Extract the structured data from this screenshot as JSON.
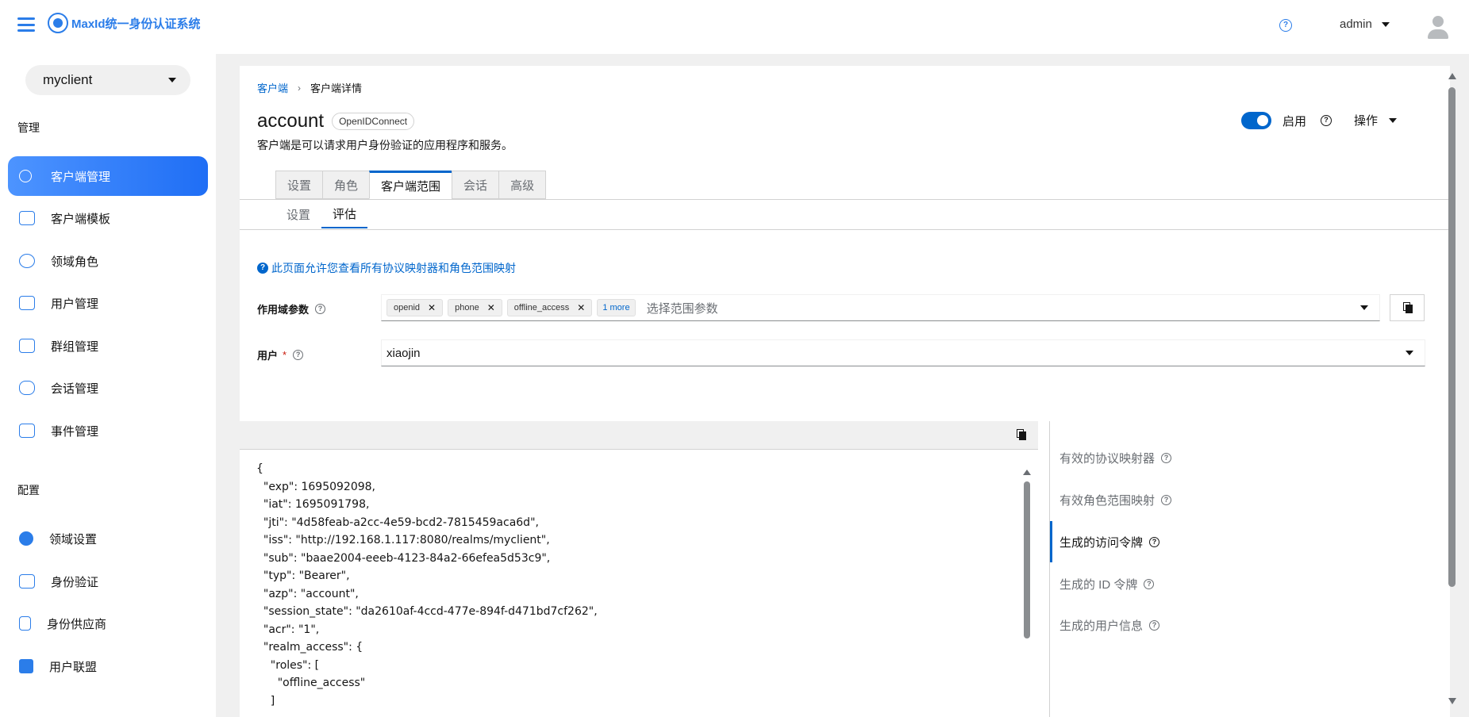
{
  "header": {
    "logo_text": "MaxId统一身份认证系统",
    "user_name": "admin"
  },
  "sidebar": {
    "realm": "myclient",
    "manage_title": "管理",
    "config_title": "配置",
    "manage_items": [
      {
        "label": "客户端管理"
      },
      {
        "label": "客户端模板"
      },
      {
        "label": "领域角色"
      },
      {
        "label": "用户管理"
      },
      {
        "label": "群组管理"
      },
      {
        "label": "会话管理"
      },
      {
        "label": "事件管理"
      }
    ],
    "config_items": [
      {
        "label": "领域设置"
      },
      {
        "label": "身份验证"
      },
      {
        "label": "身份供应商"
      },
      {
        "label": "用户联盟"
      }
    ]
  },
  "breadcrumb": {
    "parent": "客户端",
    "current": "客户端详情"
  },
  "page": {
    "title": "account",
    "protocol_badge": "OpenIDConnect",
    "subtitle": "客户端是可以请求用户身份验证的应用程序和服务。",
    "enabled_label": "启用",
    "actions_label": "操作"
  },
  "tabs": [
    {
      "label": "设置"
    },
    {
      "label": "角色"
    },
    {
      "label": "客户端范围"
    },
    {
      "label": "会话"
    },
    {
      "label": "高级"
    }
  ],
  "subtabs": [
    {
      "label": "设置"
    },
    {
      "label": "评估"
    }
  ],
  "evaluate": {
    "info_text": "此页面允许您查看所有协议映射器和角色范围映射",
    "scope_label": "作用域参数",
    "scope_chips": [
      {
        "label": "openid"
      },
      {
        "label": "phone"
      },
      {
        "label": "offline_access"
      }
    ],
    "scope_more": "1 more",
    "scope_placeholder": "选择范围参数",
    "user_label": "用户",
    "user_required": "*",
    "user_value": "xiaojin"
  },
  "code_lines": [
    "{",
    "  \"exp\": 1695092098,",
    "  \"iat\": 1695091798,",
    "  \"jti\": \"4d58feab-a2cc-4e59-bcd2-7815459aca6d\",",
    "  \"iss\": \"http://192.168.1.117:8080/realms/myclient\",",
    "  \"sub\": \"baae2004-eeeb-4123-84a2-66efea5d53c9\",",
    "  \"typ\": \"Bearer\",",
    "  \"azp\": \"account\",",
    "  \"session_state\": \"da2610af-4ccd-477e-894f-d471bd7cf262\",",
    "  \"acr\": \"1\",",
    "  \"realm_access\": {",
    "    \"roles\": [",
    "      \"offline_access\"",
    "    ]"
  ],
  "side_tabs": [
    {
      "label": "有效的协议映射器"
    },
    {
      "label": "有效角色范围映射"
    },
    {
      "label": "生成的访问令牌"
    },
    {
      "label": "生成的 ID 令牌"
    },
    {
      "label": "生成的用户信息"
    }
  ]
}
